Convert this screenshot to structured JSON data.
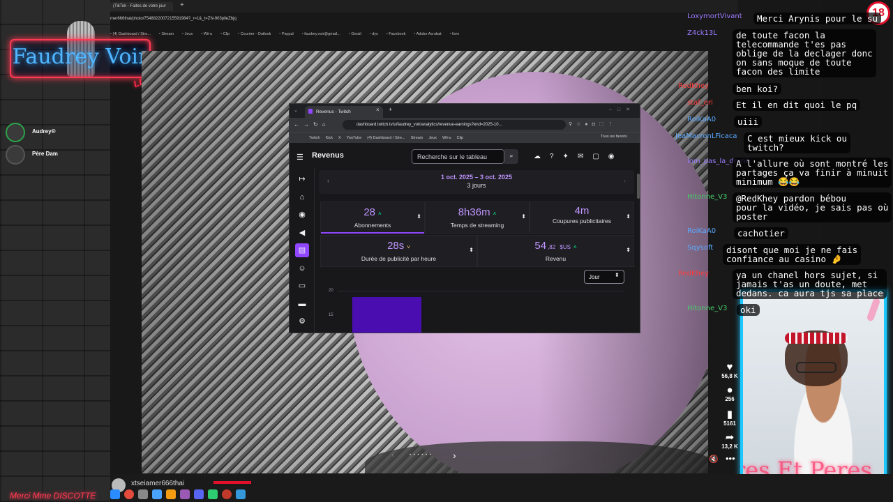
{
  "overlay": {
    "logo_text": "Faudrey Voir",
    "logo_live": "LIVE",
    "viewers": [
      "Audrey®",
      "Père Dam"
    ],
    "bottom_neon": "Merci Mme DISCOTTE",
    "age_badge": "18",
    "webcam_text": "res Et Peres"
  },
  "bg_browser": {
    "tab_title": "(TikTok - Faites de votre jour",
    "url": "mer666thai/photo/7548822007215591984?_r=1&_t=ZN-903plleZbjq",
    "bookmarks": [
      "(4) Dashboard / Stre...",
      "Stream",
      "Jeux",
      "Wii-u",
      "Clip",
      "Courrier - Outlook",
      "Paypal",
      "faudrey.voir@gmail...",
      "Gmail",
      "dys",
      "Facebook",
      "Adobe Acrobat",
      "livre"
    ]
  },
  "video": {
    "nav_dots": "• • • • • •",
    "prev": "‹",
    "next": "›"
  },
  "inner_browser": {
    "tab_title": "Revenus - Twitch",
    "url": "dashboard.twitch.tv/u/faudrey_voir/analytics/revenue-earnings?end=2025-10...",
    "bookmarks": [
      "Twitch",
      "Kick",
      "X",
      "YouTube",
      "(4) Dashboard / Stre...",
      "Stream",
      "Jeux",
      "Wii-u",
      "Clip"
    ],
    "bookmarks_right": "Tous les favoris"
  },
  "twitch": {
    "page_title": "Revenus",
    "search_placeholder": "Recherche sur le tableau",
    "date_range": "1 oct. 2025 – 3 oct. 2025",
    "days": "3 jours",
    "stats": {
      "abonnements": {
        "value": "28",
        "label": "Abonnements",
        "trend": "up"
      },
      "temps_streaming": {
        "value": "8h36m",
        "label": "Temps de streaming",
        "trend": "up"
      },
      "coupures": {
        "value": "4m",
        "label": "Coupures publicitaires"
      },
      "duree_pub": {
        "value": "28s",
        "label": "Durée de publicité par heure",
        "trend": "down"
      },
      "revenu": {
        "value": "54",
        "decimals": ",82",
        "unit": "$US",
        "label": "Revenu",
        "trend": "up"
      }
    },
    "granularity": "Jour",
    "chart_ticks": [
      "20",
      "15"
    ],
    "colors": {
      "accent": "#9147ff",
      "text_accent": "#bf94ff",
      "up": "#00f593"
    }
  },
  "chat": {
    "messages": [
      {
        "user": "LoxymortVivant",
        "text": "Merci Arynis pour le su"
      },
      {
        "user": "Z4ck13L",
        "text": "de toute facon la\ntelecommande t'es pas\noblige de la declager donc\non sans moque de toute\nfacon des limite"
      },
      {
        "user": "RedKhey",
        "text": "ben koi?"
      },
      {
        "user": "staf_eri",
        "text": "Et il en dit quoi le pq"
      },
      {
        "user": "RoiKaA0",
        "text": "uiii"
      },
      {
        "user": "JeaMacronLFicaca",
        "text": "C est mieux kick ou\ntwitch?"
      },
      {
        "user": "lom_pas_la_drunk",
        "text": "A l'allure où sont montré les\npartages ça va finir à minuit\nminimum 😂😂"
      },
      {
        "user": "Hitonne_V3",
        "text": "@RedKhey pardon bébou\npour la vidéo, je sais pas où\nposter"
      },
      {
        "user": "RoiKaA0",
        "text": "cachotier"
      },
      {
        "user": "Sqysoft",
        "text": "disont que moi je ne fais\nconfiance au casino 🤌"
      },
      {
        "user": "RedKhey",
        "text": "ya un chanel hors sujet, si\njamais t'as un doute, met\ndedans. ca aura tjs sa place"
      },
      {
        "user": "Hitonne_V3",
        "text": "oki"
      }
    ]
  },
  "tiktok": {
    "likes": "56,8 K",
    "comments": "256",
    "saves": "5161",
    "shares": "13,2 K"
  },
  "bottom": {
    "username": "xtseiamer666thai"
  }
}
